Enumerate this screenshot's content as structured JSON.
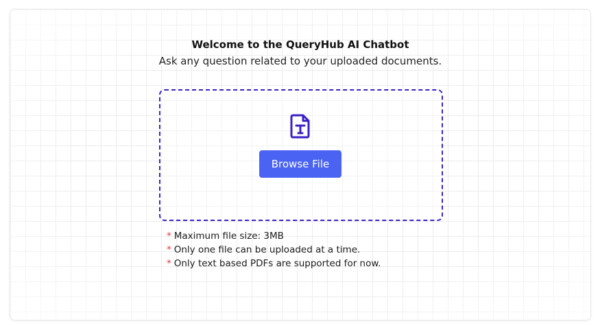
{
  "header": {
    "title": "Welcome to the QueryHub AI Chatbot",
    "subtitle": "Ask any question related to your uploaded documents."
  },
  "upload": {
    "icon": "text-file-icon",
    "icon_color": "#3a1fc4",
    "button_label": "Browse File",
    "button_color": "#4b63f3"
  },
  "notes": [
    {
      "marker": "*",
      "text": "Maximum file size: 3MB"
    },
    {
      "marker": "*",
      "text": "Only one file can be uploaded at a time."
    },
    {
      "marker": "*",
      "text": "Only text based PDFs are supported for now."
    }
  ]
}
